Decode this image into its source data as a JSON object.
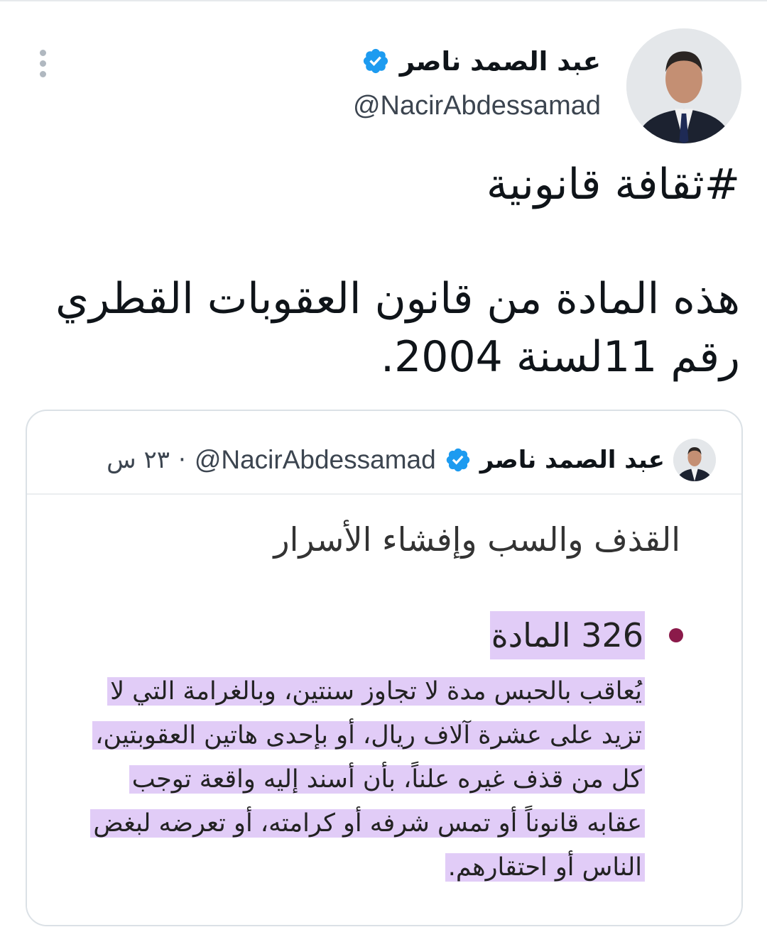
{
  "author": {
    "display_name": "عبد الصمد ناصر",
    "handle": "@NacirAbdessamad",
    "verified": true
  },
  "tweet": {
    "hashtag": "#ثقافة_قانونية",
    "hashtag_display": "#ثقافة قانونية",
    "text": "هذه المادة من قانون العقوبات القطري رقم 11لسنة 2004."
  },
  "quoted_tweet": {
    "display_name": "عبد الصمد ناصر",
    "handle": "@NacirAbdessamad",
    "separator": "·",
    "time": "٢٣ س",
    "verified": true,
    "media": {
      "title": "القذف والسب وإفشاء الأسرار",
      "article_number": "326 المادة",
      "article_lines": [
        "يُعاقب بالحبس مدة لا تجاوز سنتين، وبالغرامة التي لا",
        "تزيد على عشرة آلاف ريال، أو بإحدى هاتين العقوبتين،",
        "كل من قذف غيره علناً، بأن أسند إليه واقعة توجب",
        "عقابه قانوناً أو تمس شرفه أو كرامته، أو تعرضه لبغض",
        "الناس أو احتقارهم."
      ]
    }
  },
  "icons": {
    "verified": "verified-badge-icon",
    "more": "more-options-icon"
  },
  "colors": {
    "verified_blue": "#1d9bf0",
    "highlight": "#e1ccf7",
    "bullet": "#8b1a4a",
    "border": "#dbe1e6"
  }
}
